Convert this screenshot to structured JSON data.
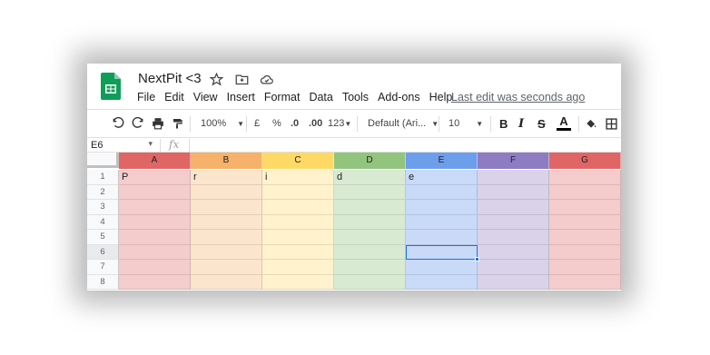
{
  "document": {
    "title": "NextPit <3"
  },
  "menu": [
    "File",
    "Edit",
    "View",
    "Insert",
    "Format",
    "Data",
    "Tools",
    "Add-ons",
    "Help"
  ],
  "last_edit": "Last edit was seconds ago",
  "toolbar": {
    "zoom": "100%",
    "currency": "£",
    "percent": "%",
    "decrease_decimal": ".0",
    "increase_decimal": ".00",
    "more_formats": "123",
    "font": "Default (Ari...",
    "font_size": "10",
    "bold": "B",
    "italic": "I",
    "strikethrough": "S",
    "text_color": "A"
  },
  "formula_bar": {
    "name_box": "E6",
    "fx": "fx",
    "content": ""
  },
  "columns": [
    {
      "label": "A",
      "header_color": "#e06666",
      "cell_color": "#f4cccc"
    },
    {
      "label": "B",
      "header_color": "#f6b26b",
      "cell_color": "#fce5cd"
    },
    {
      "label": "C",
      "header_color": "#ffd966",
      "cell_color": "#fff2cc"
    },
    {
      "label": "D",
      "header_color": "#93c47d",
      "cell_color": "#d9ead3"
    },
    {
      "label": "E",
      "header_color": "#6d9eeb",
      "cell_color": "#c9daf8"
    },
    {
      "label": "F",
      "header_color": "#8e7cc3",
      "cell_color": "#d9d2e9"
    },
    {
      "label": "G",
      "header_color": "#e06666",
      "cell_color": "#f4cccc"
    }
  ],
  "rows": [
    "1",
    "2",
    "3",
    "4",
    "5",
    "6",
    "7",
    "8"
  ],
  "cells": {
    "row1": [
      "P",
      "r",
      "i",
      "d",
      "e",
      "",
      ""
    ]
  },
  "selected_cell": "E6",
  "colors": {
    "accent": "#1a73e8",
    "sheets_green": "#0f9d58"
  }
}
